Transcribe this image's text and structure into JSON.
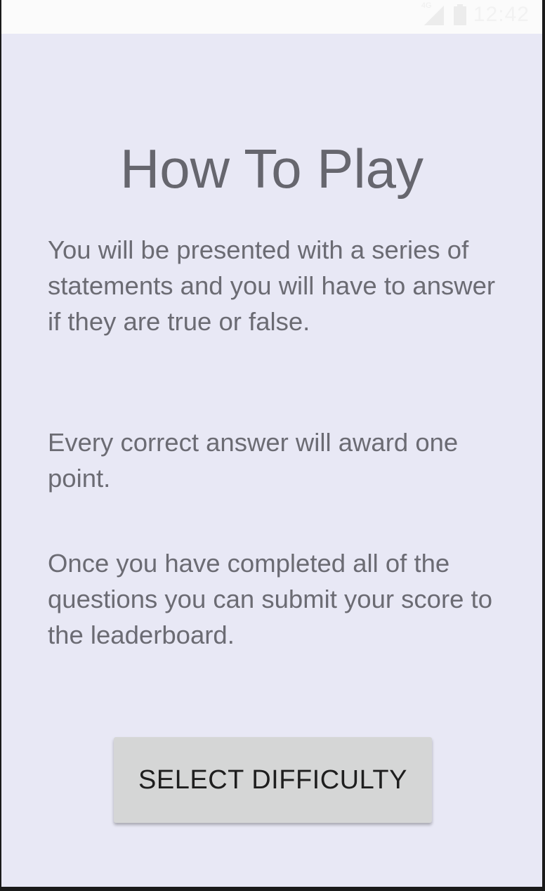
{
  "status_bar": {
    "network_type": "4G",
    "time": "12:42",
    "icons": [
      "signal-icon",
      "battery-icon"
    ]
  },
  "screen": {
    "title": "How To Play",
    "paragraphs": [
      "You will be presented with a series of statements and you will have to answer if they are true or false.",
      "Every correct answer will award one point.",
      "Once you have completed all of the questions you can submit your score to the leaderboard."
    ],
    "select_difficulty_label": "SELECT DIFFICULTY"
  },
  "colors": {
    "background": "#e8e8f5",
    "text": "#6b6b73",
    "button": "#d5d6d6"
  }
}
